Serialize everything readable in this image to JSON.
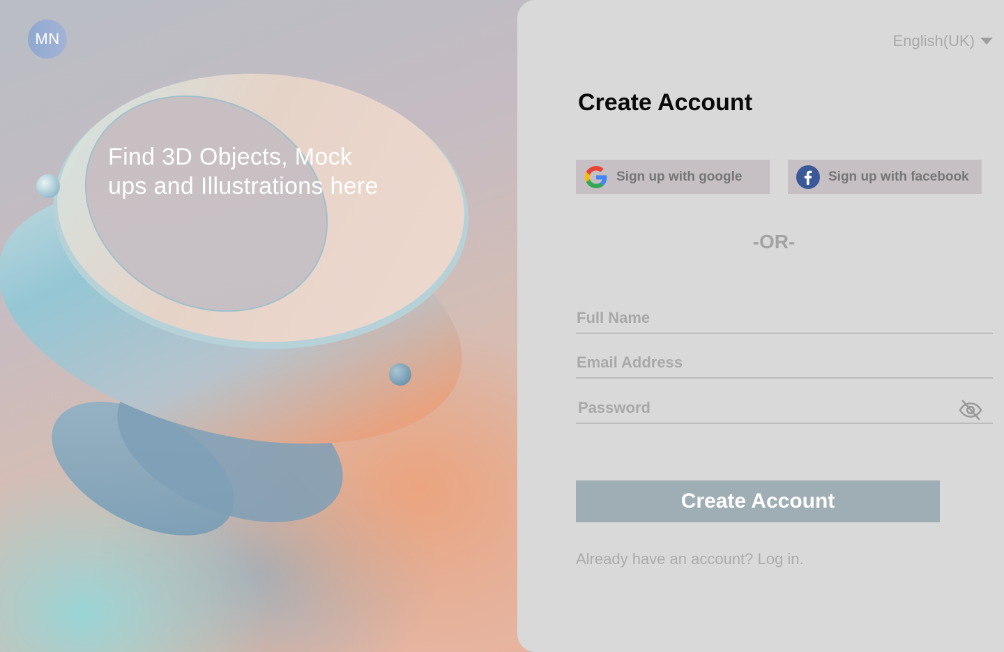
{
  "hero": {
    "logo_text": "MN",
    "tagline_line1": "Find 3D Objects, Mock",
    "tagline_line2": "ups and Illustrations here"
  },
  "panel": {
    "language": "English(UK)",
    "title": "Create Account",
    "social": {
      "google_label": "Sign up with google",
      "facebook_label": "Sign up with facebook"
    },
    "divider": "-OR-",
    "form": {
      "full_name_placeholder": "Full Name",
      "email_placeholder": "Email Address",
      "password_placeholder": "Password",
      "full_name_value": "",
      "email_value": "",
      "password_value": ""
    },
    "submit_label": "Create Account",
    "login_prompt": "Already have an account? Log in."
  },
  "icons": {
    "language_caret": "chevron-down-icon",
    "google": "google-icon",
    "facebook": "facebook-icon",
    "password_toggle": "eye-off-icon"
  },
  "colors": {
    "panel_bg": "#d9d9d9",
    "social_button_bg": "#c6bfc4",
    "submit_bg": "#9fadb5",
    "google_blue": "#4285F4",
    "google_red": "#EA4335",
    "google_yellow": "#FBBC05",
    "google_green": "#34A853",
    "facebook_blue": "#3b5998"
  }
}
